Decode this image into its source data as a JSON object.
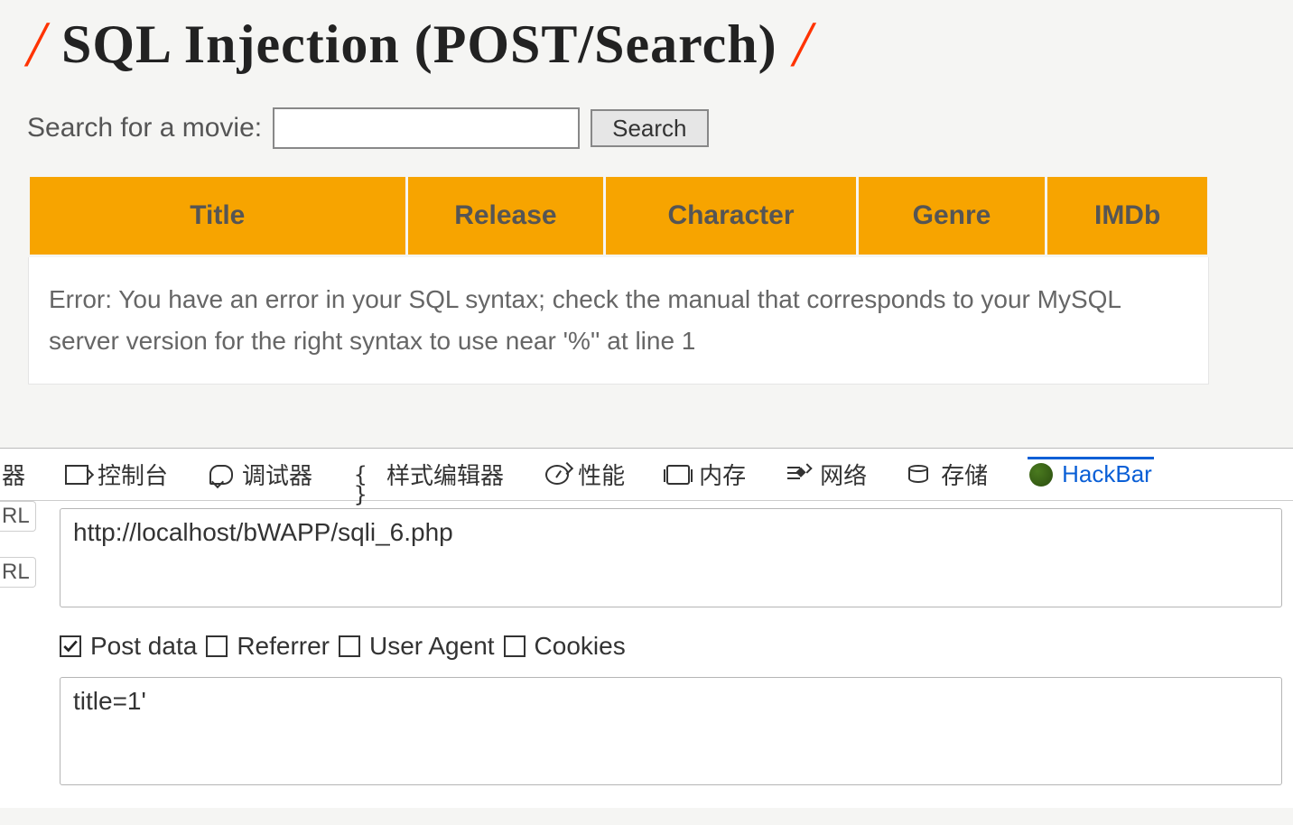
{
  "page": {
    "title": "SQL Injection (POST/Search)"
  },
  "search": {
    "label": "Search for a movie:",
    "value": "",
    "button": "Search"
  },
  "table": {
    "headers": [
      "Title",
      "Release",
      "Character",
      "Genre",
      "IMDb"
    ],
    "error": "Error: You have an error in your SQL syntax; check the manual that corresponds to your MySQL server version for the right syntax to use near '%'' at line 1"
  },
  "devtools": {
    "truncated_tab": "器",
    "tabs": {
      "console": "控制台",
      "debugger": "调试器",
      "style": "样式编辑器",
      "performance": "性能",
      "memory": "内存",
      "network": "网络",
      "storage": "存储",
      "hackbar": "HackBar"
    },
    "side_labels": {
      "rl1": "RL",
      "rl2": "RL"
    },
    "url": "http://localhost/bWAPP/sqli_6.php",
    "checkboxes": {
      "post_data": {
        "label": "Post data",
        "checked": true
      },
      "referrer": {
        "label": "Referrer",
        "checked": false
      },
      "user_agent": {
        "label": "User Agent",
        "checked": false
      },
      "cookies": {
        "label": "Cookies",
        "checked": false
      }
    },
    "post_data_value": "title=1'"
  }
}
